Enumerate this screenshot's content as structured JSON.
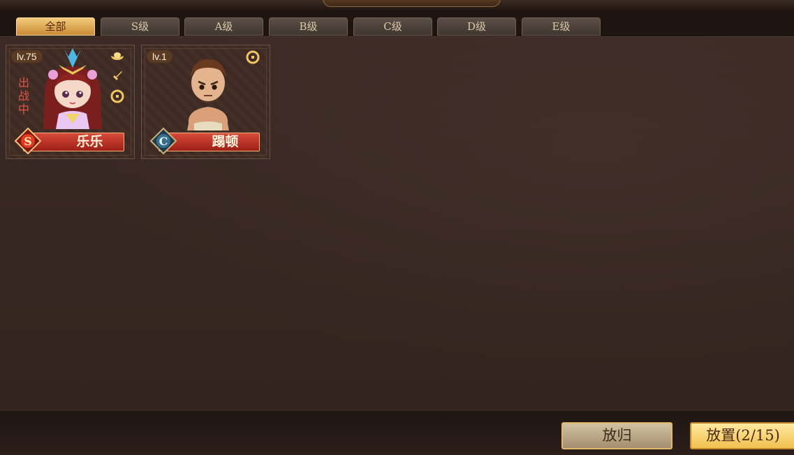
{
  "tabs": [
    {
      "label": "全部",
      "active": true
    },
    {
      "label": "S级",
      "active": false
    },
    {
      "label": "A级",
      "active": false
    },
    {
      "label": "B级",
      "active": false
    },
    {
      "label": "C级",
      "active": false
    },
    {
      "label": "D级",
      "active": false
    },
    {
      "label": "E级",
      "active": false
    }
  ],
  "heroes": [
    {
      "level": "lv.75",
      "status": "出战中",
      "name": "乐乐",
      "grade": "S",
      "icons": [
        "gold-ingot-icon",
        "sword-icon",
        "copper-coin-icon"
      ]
    },
    {
      "level": "lv.1",
      "status": "",
      "name": "蹋顿",
      "grade": "C",
      "icons": [
        "copper-coin-icon"
      ]
    }
  ],
  "footer": {
    "return_label": "放归",
    "place_label": "放置(2/15)"
  },
  "colors": {
    "grade_S": "#d8281c",
    "grade_C": "#3a6f8c",
    "accent_gold": "#f2c04f"
  }
}
